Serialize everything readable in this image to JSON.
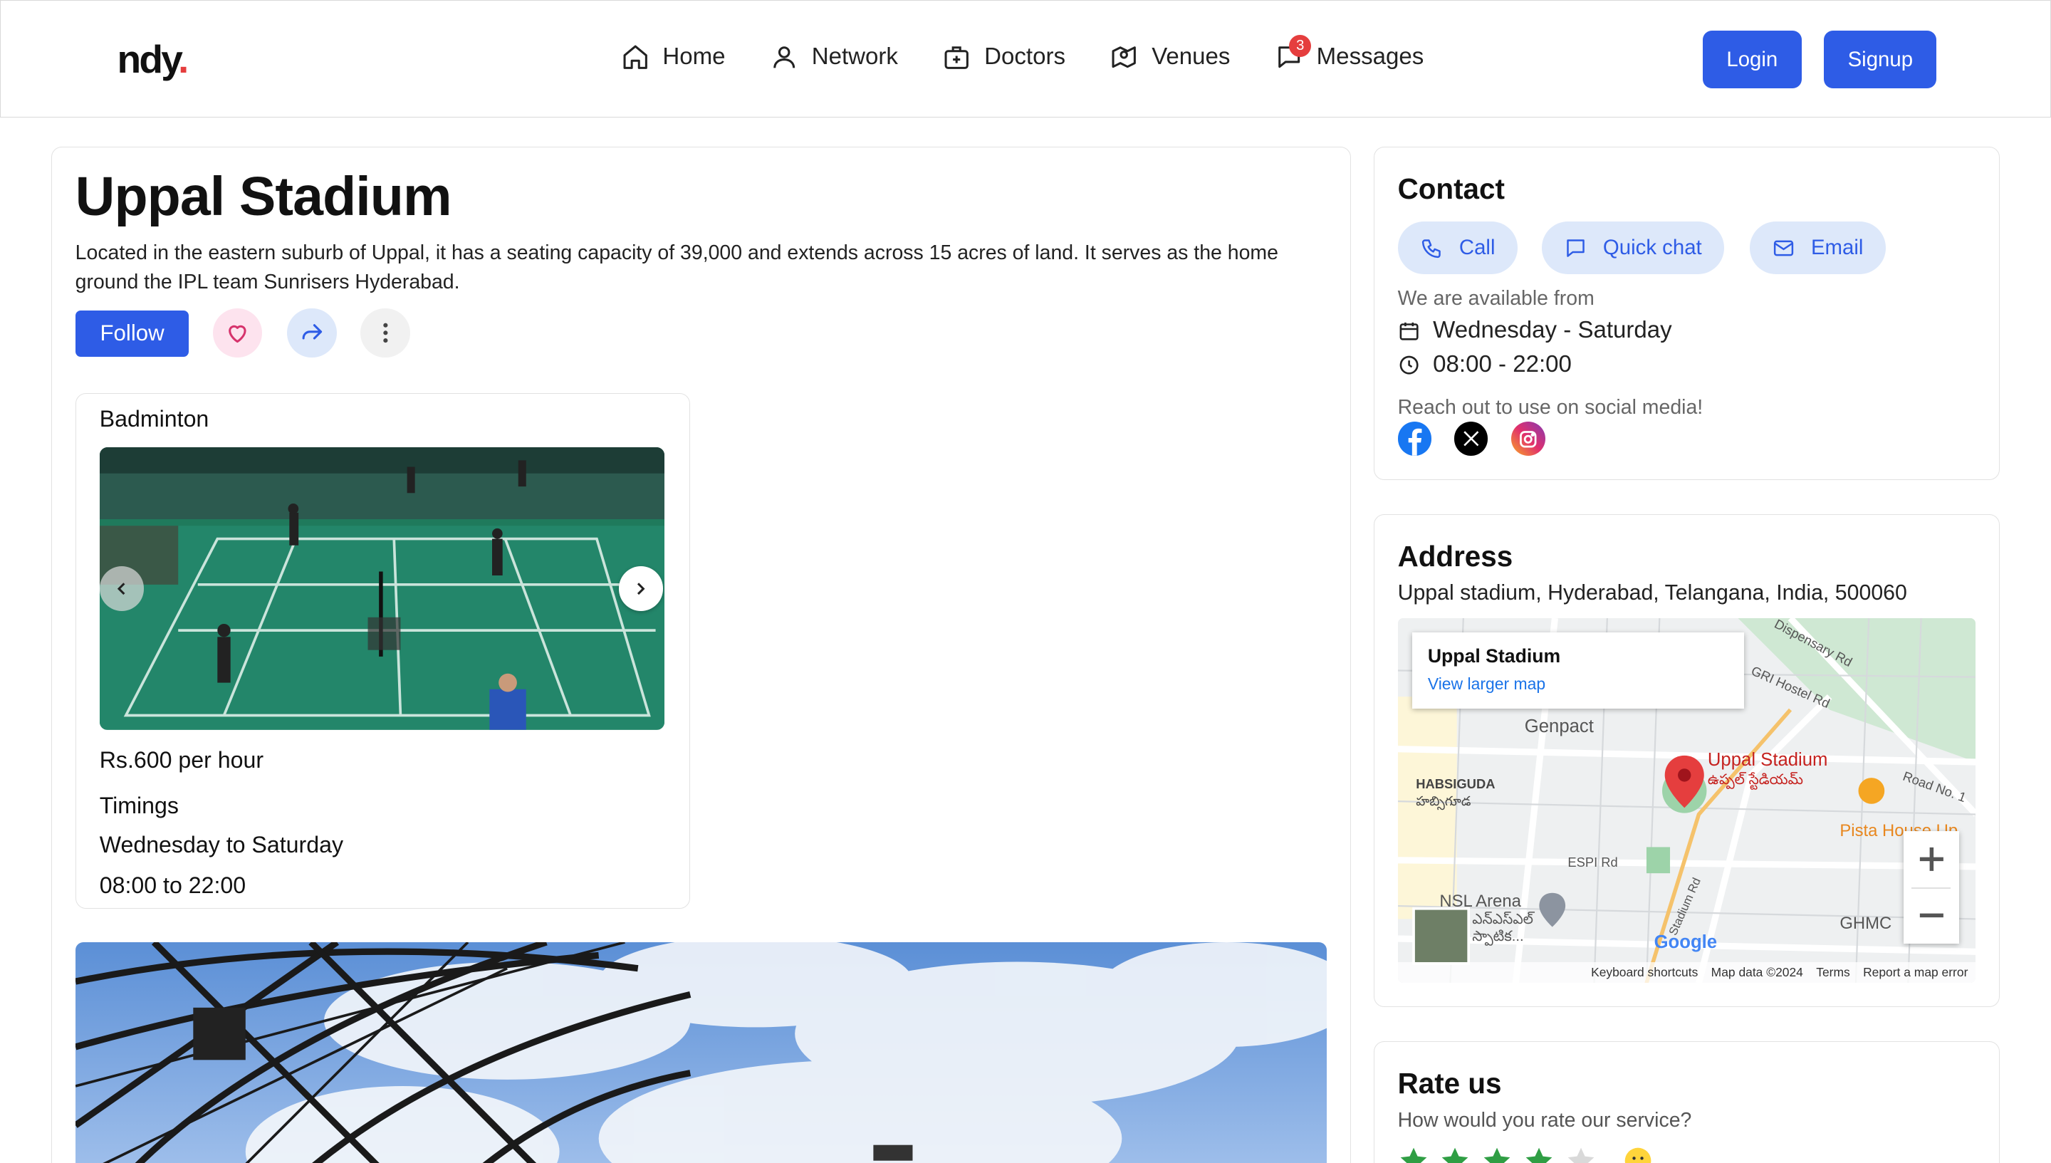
{
  "header": {
    "logo_main": "ndy",
    "logo_dot": ".",
    "nav": [
      {
        "label": "Home",
        "icon": "home-icon"
      },
      {
        "label": "Network",
        "icon": "user-icon"
      },
      {
        "label": "Doctors",
        "icon": "medical-bag-icon"
      },
      {
        "label": "Venues",
        "icon": "map-location-icon"
      },
      {
        "label": "Messages",
        "icon": "chat-icon",
        "badge": "3"
      }
    ],
    "login_label": "Login",
    "signup_label": "Signup"
  },
  "colors": {
    "accent": "#2e5ce6",
    "badge": "#e53e3e",
    "pill_bg": "#dde8fa"
  },
  "venue": {
    "title": "Uppal Stadium",
    "description": "Located in the eastern suburb of Uppal, it has a seating capacity of 39,000 and extends across 15 acres of land. It serves as the home ground the IPL team Sunrisers Hyderabad.",
    "follow_label": "Follow"
  },
  "sport_card": {
    "name": "Badminton",
    "price": "Rs.600 per hour",
    "timings_label": "Timings",
    "days": "Wednesday to Saturday",
    "hours": "08:00 to 22:00"
  },
  "contact": {
    "title": "Contact",
    "call_label": "Call",
    "chat_label": "Quick chat",
    "email_label": "Email",
    "available_label": "We are available from",
    "days": "Wednesday - Saturday",
    "hours": "08:00 - 22:00",
    "social_label": "Reach out to use on social media!"
  },
  "address": {
    "title": "Address",
    "text": "Uppal stadium, Hyderabad, Telangana, India, 500060",
    "map": {
      "popup_title": "Uppal Stadium",
      "popup_link": "View larger map",
      "place_label": "Uppal Stadium",
      "place_label_te": "ఉప్పల్ స్టేడియమ్",
      "genpact": "Genpact",
      "habsiguda": "HABSIGUDA",
      "habsiguda_te": "హబ్సిగూడ",
      "espi": "ESPI Rd",
      "nsl": "NSL Arena",
      "nsl_te": "ఎన్ఎస్ఎల్",
      "nsl_te2": "స్పాటిక...",
      "pista": "Pista House Up",
      "ghmc": "GHMC",
      "dispensary": "Dispensary Rd",
      "gri": "GRI Hostel Rd",
      "roadno": "Road No. 1",
      "stadium_rd": "Stadium Rd",
      "google": "Google",
      "keyboard": "Keyboard shortcuts",
      "mapdata": "Map data ©2024",
      "terms": "Terms",
      "report": "Report a map error"
    }
  },
  "rate": {
    "title": "Rate us",
    "question": "How would you rate our service?",
    "rating": 4,
    "max": 5
  }
}
